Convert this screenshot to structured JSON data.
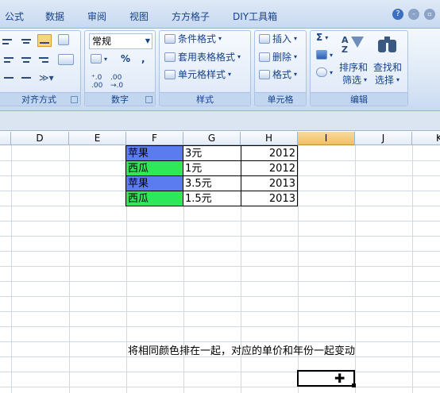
{
  "ribbon": {
    "tabs": [
      "公式",
      "数据",
      "审阅",
      "视图",
      "方方格子",
      "DIY工具箱"
    ],
    "help_icon": "question-icon",
    "groups": {
      "alignment": {
        "label": "对齐方式"
      },
      "number": {
        "label": "数字",
        "format_value": "常规",
        "percent": "%",
        "comma": ","
      },
      "styles": {
        "label": "样式",
        "conditional": "条件格式",
        "table": "套用表格格式",
        "cell_styles": "单元格样式"
      },
      "cells": {
        "label": "单元格",
        "insert": "插入",
        "delete": "删除",
        "format": "格式"
      },
      "editing": {
        "label": "编辑",
        "sigma": "Σ",
        "sort_line1": "排序和",
        "sort_line2": "筛选",
        "find_line1": "查找和",
        "find_line2": "选择"
      }
    }
  },
  "sheet": {
    "columns": [
      "D",
      "E",
      "F",
      "G",
      "H",
      "I",
      "J",
      "K"
    ],
    "selected_column": "I",
    "rows": [
      {
        "fruit": "苹果",
        "fruit_color": "#5b7cf0",
        "price": "3元",
        "year": "2012"
      },
      {
        "fruit": "西瓜",
        "fruit_color": "#2ee85a",
        "price": "1元",
        "year": "2012"
      },
      {
        "fruit": "苹果",
        "fruit_color": "#5b7cf0",
        "price": "3.5元",
        "year": "2013"
      },
      {
        "fruit": "西瓜",
        "fruit_color": "#2ee85a",
        "price": "1.5元",
        "year": "2013"
      }
    ],
    "note": "将相同颜色排在一起，对应的单价和年份一起变动"
  }
}
